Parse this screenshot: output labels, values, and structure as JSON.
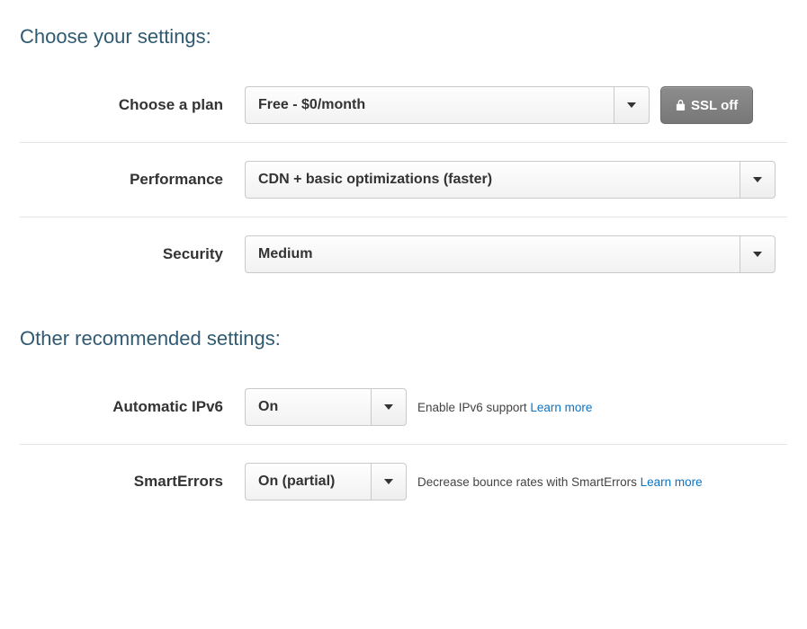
{
  "section1": {
    "heading": "Choose your settings:",
    "plan": {
      "label": "Choose a plan",
      "value": "Free - $0/month"
    },
    "ssl_button": "SSL off",
    "performance": {
      "label": "Performance",
      "value": "CDN + basic optimizations (faster)"
    },
    "security": {
      "label": "Security",
      "value": "Medium"
    }
  },
  "section2": {
    "heading": "Other recommended settings:",
    "ipv6": {
      "label": "Automatic IPv6",
      "value": "On",
      "hint": "Enable IPv6 support ",
      "learn_more": "Learn more"
    },
    "smarterrors": {
      "label": "SmartErrors",
      "value": "On (partial)",
      "hint": "Decrease bounce rates with SmartErrors ",
      "learn_more": "Learn more"
    }
  }
}
